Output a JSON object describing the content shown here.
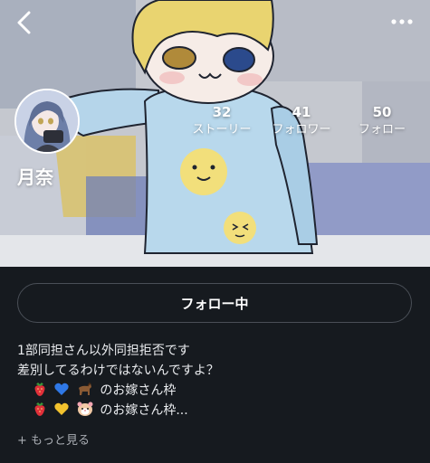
{
  "profile": {
    "username": "月奈",
    "stats": [
      {
        "value": "32",
        "label": "ストーリー"
      },
      {
        "value": "41",
        "label": "フォロワー"
      },
      {
        "value": "50",
        "label": "フォロー"
      }
    ]
  },
  "actions": {
    "follow_label": "フォロー中"
  },
  "bio": {
    "line1": "1部同担さん以外同担拒否です",
    "line2": "差別してるわけではないんですよ？",
    "line3_text": "のお嫁さん枠",
    "line4_text": "のお嫁さん枠...",
    "line3_icons": [
      "strawberry-icon",
      "blue-heart-icon",
      "horse-icon"
    ],
    "line4_icons": [
      "strawberry-icon",
      "yellow-heart-icon",
      "hamster-icon"
    ],
    "more_label": "+ もっと見る"
  },
  "icons": {
    "back": "chevron-left-icon",
    "menu": "more-horizontal-icon"
  },
  "colors": {
    "background": "#161a1f",
    "button_border": "#4a4f57"
  }
}
